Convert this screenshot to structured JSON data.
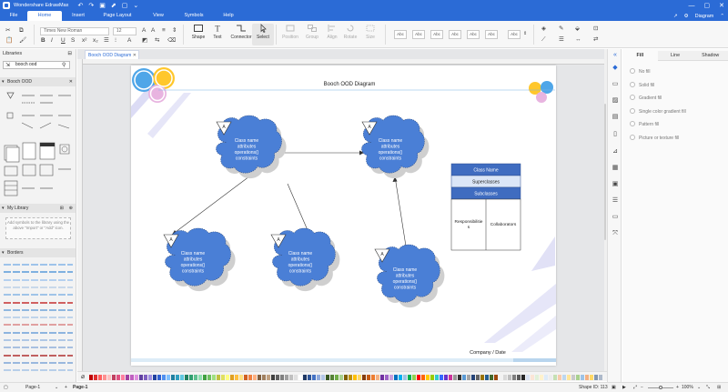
{
  "app": {
    "title": "Wondershare EdrawMax",
    "quick_access": [
      "↶",
      "↷",
      "▣",
      "⬈",
      "▢",
      "⌄"
    ],
    "window_controls": [
      "—",
      "▢",
      "✕"
    ]
  },
  "menu": {
    "tabs": [
      "File",
      "Home",
      "Insert",
      "Page Layout",
      "View",
      "Symbols",
      "Help"
    ],
    "active": "Home",
    "right_items": [
      "↗",
      "⚙",
      "Diagram",
      "⌃"
    ],
    "diagram_label": "Diagram"
  },
  "ribbon": {
    "font_name": "Times New Roman",
    "font_size": "12",
    "tools": [
      {
        "label": "Shape",
        "dim": false
      },
      {
        "label": "Text",
        "dim": false
      },
      {
        "label": "Connector",
        "dim": false
      },
      {
        "label": "Select",
        "dim": false
      },
      {
        "label": "Position",
        "dim": true
      },
      {
        "label": "Group",
        "dim": true
      },
      {
        "label": "Align",
        "dim": true
      },
      {
        "label": "Rotate",
        "dim": true
      },
      {
        "label": "Size",
        "dim": true
      }
    ],
    "style_box_label": "Abc"
  },
  "left_panel": {
    "libraries_label": "Libraries",
    "search_value": "booch ood",
    "section_booch": "Booch OOD",
    "section_my_library": "My Library",
    "my_library_hint": "Add symbols to the library using the above \"Import\" or \"Add\" icon.",
    "section_borders": "Borders"
  },
  "document": {
    "tab_label": "Booch OOD Diagram",
    "title": "Booch OOD Diagram",
    "footer": "Company / Date",
    "cloud_text": [
      "Class name",
      "attributes",
      "operations()",
      "constraints"
    ],
    "class_marker": "A",
    "class_card": {
      "name": "Class Name",
      "superclasses": "Superclasses",
      "subclasses": "Subclasses",
      "responsibilities": [
        "Responsibilitie",
        "s"
      ],
      "collaborators": "Collaborators"
    }
  },
  "right_panel": {
    "tabs": [
      "Fill",
      "Line",
      "Shadow"
    ],
    "active_tab": "Fill",
    "fill_options": [
      "No fill",
      "Solid fill",
      "Gradient fill",
      "Single color gradient fill",
      "Pattern fill",
      "Picture or texture fill"
    ]
  },
  "status": {
    "page_selector": "Page-1",
    "page_tab": "Page-1",
    "shape_id": "Shape ID: 113",
    "zoom": "100%"
  },
  "colors": {
    "accent": "#2b6bd6",
    "cloud": "#4a7fd6",
    "cloud_shadow": "#c8c8c8",
    "card_header": "#3f6cc0",
    "card_alt": "#dbe6f7"
  }
}
